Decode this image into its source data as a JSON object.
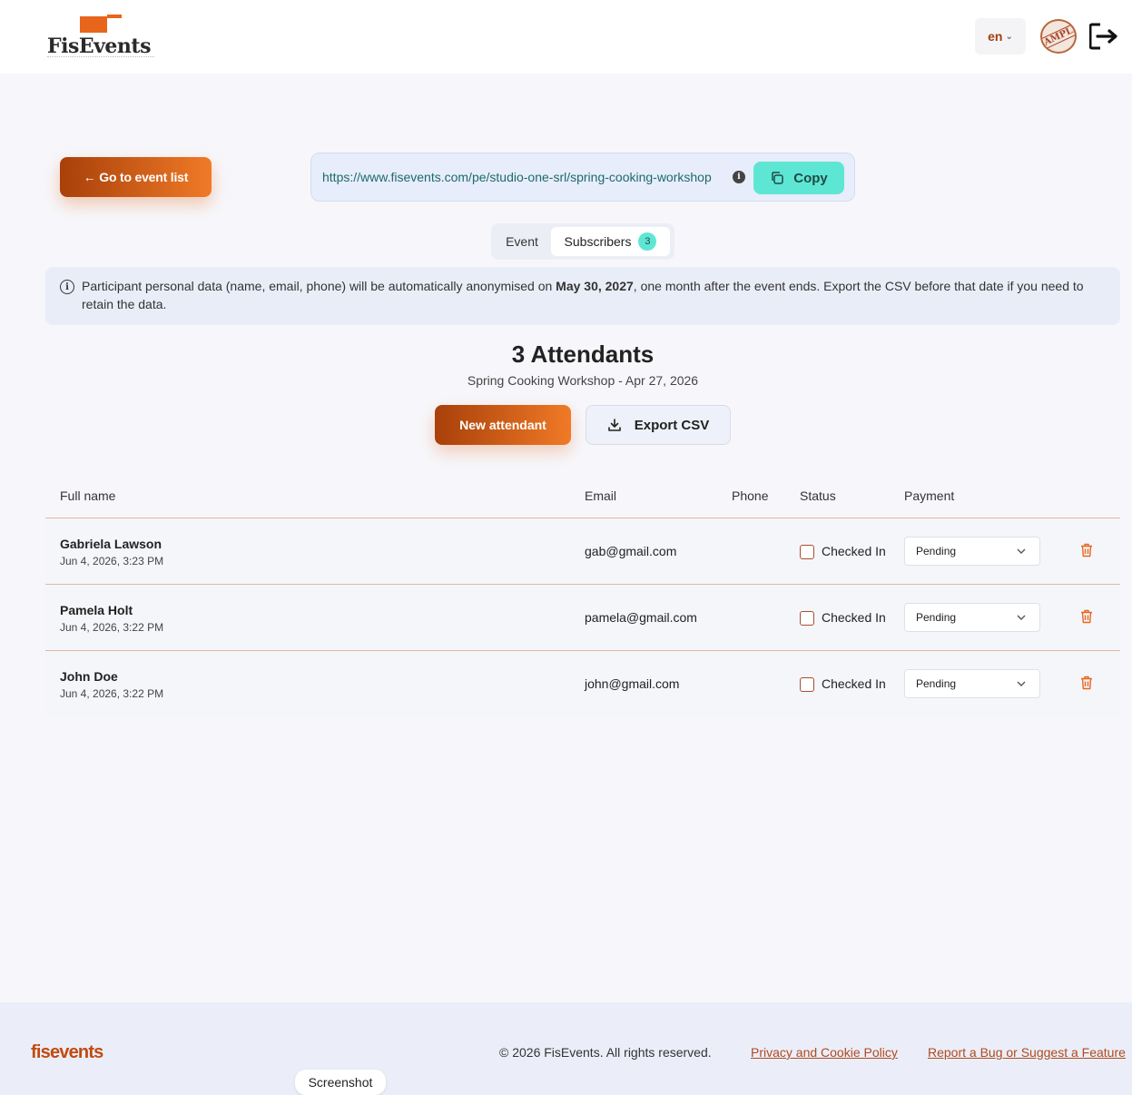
{
  "header": {
    "logo_text": "FisEvents",
    "language": "en",
    "avatar_text": "SAMPLE"
  },
  "actions": {
    "back_label": "← Go to event list",
    "event_url": "https://www.fisevents.com/pe/studio-one-srl/spring-cooking-workshop",
    "copy_label": "Copy"
  },
  "tabs": {
    "event_label": "Event",
    "subscribers_label": "Subscribers",
    "subscribers_count": "3"
  },
  "notice": {
    "text_before": "Participant personal data (name, email, phone) will be automatically anonymised on ",
    "date": "May 30, 2027",
    "text_after": ", one month after the event ends. Export the CSV before that date if you need to retain the data."
  },
  "attendants": {
    "title": "3 Attendants",
    "subtitle": "Spring Cooking Workshop - Apr 27, 2026",
    "new_label": "New attendant",
    "export_label": "Export CSV"
  },
  "table": {
    "headers": {
      "full_name": "Full name",
      "email": "Email",
      "phone": "Phone",
      "status": "Status",
      "payment": "Payment"
    },
    "rows": [
      {
        "name": "Gabriela Lawson",
        "date": "Jun 4, 2026, 3:23 PM",
        "email": "gab@gmail.com",
        "phone": "",
        "status": "Checked In",
        "checked": false,
        "payment": "Pending"
      },
      {
        "name": "Pamela Holt",
        "date": "Jun 4, 2026, 3:22 PM",
        "email": "pamela@gmail.com",
        "phone": "",
        "status": "Checked In",
        "checked": false,
        "payment": "Pending"
      },
      {
        "name": "John Doe",
        "date": "Jun 4, 2026, 3:22 PM",
        "email": "john@gmail.com",
        "phone": "",
        "status": "Checked In",
        "checked": false,
        "payment": "Pending"
      }
    ]
  },
  "footer": {
    "logo": "fisevents",
    "copyright": "© 2026 FisEvents. All rights reserved.",
    "privacy_link": "Privacy and Cookie Policy",
    "report_link": "Report a Bug or Suggest a Feature"
  },
  "overlay": {
    "screenshot_label": "Screenshot"
  },
  "colors": {
    "accent": "#e8651c",
    "accent_dark": "#a8400a",
    "teal": "#5ee6d4",
    "link": "#b04a1f"
  },
  "icons": [
    "logout-icon",
    "info-icon",
    "copy-icon",
    "download-icon",
    "chevron-down-icon",
    "trash-icon"
  ]
}
